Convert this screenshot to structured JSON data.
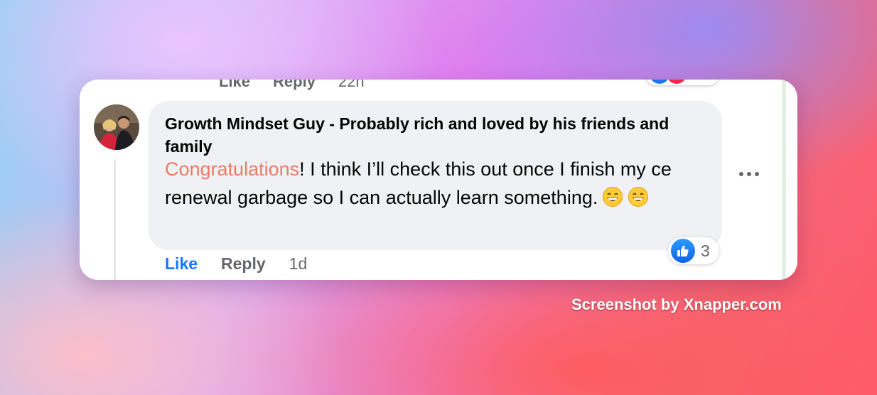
{
  "previous_comment": {
    "like_label": "Like",
    "reply_label": "Reply",
    "timestamp": "22h"
  },
  "comment": {
    "author": "Growth Mindset Guy - Probably rich and loved by his friends and family",
    "highlight_word": "Congratulations",
    "body_text": "! I think I’ll check this out once I finish my ce renewal garbage so I can actually learn something.",
    "emojis": [
      "grinning-face",
      "grinning-face"
    ],
    "reaction": {
      "icon": "thumbs-up-icon",
      "count": "3"
    },
    "actions": {
      "like_label": "Like",
      "reply_label": "Reply",
      "timestamp": "1d"
    }
  },
  "colors": {
    "like_blue": "#1877f2",
    "highlight_orange": "#ec7b63",
    "bubble_gray": "#eff1f4",
    "muted_text": "#65676b"
  },
  "watermark": "Screenshot by Xnapper.com"
}
